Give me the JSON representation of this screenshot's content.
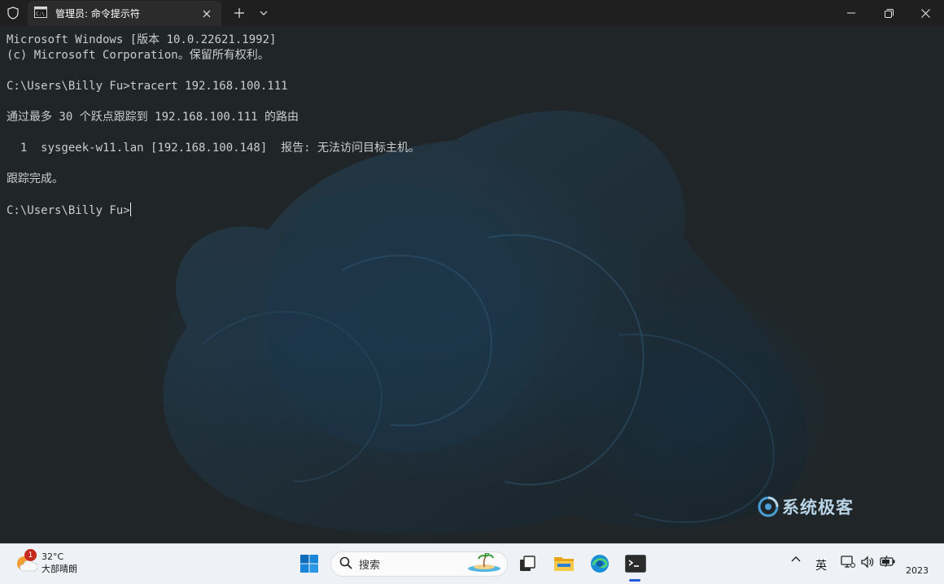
{
  "window": {
    "tab_title": "管理员: 命令提示符"
  },
  "terminal": {
    "lines": [
      "Microsoft Windows [版本 10.0.22621.1992]",
      "(c) Microsoft Corporation。保留所有权利。",
      "",
      "C:\\Users\\Billy Fu>tracert 192.168.100.111",
      "",
      "通过最多 30 个跃点跟踪到 192.168.100.111 的路由",
      "",
      "  1  sysgeek-w11.lan [192.168.100.148]  报告: 无法访问目标主机。",
      "",
      "跟踪完成。",
      "",
      "C:\\Users\\Billy Fu>"
    ]
  },
  "watermark": {
    "text": "系统极客"
  },
  "taskbar": {
    "weather": {
      "temperature": "32°C",
      "condition": "大部晴朗",
      "badge": "1"
    },
    "search_placeholder": "搜索",
    "ime_label": "英",
    "clock": "2023"
  },
  "colors": {
    "terminal_text": "#cccccc",
    "titlebar": "#1f1f1f",
    "tab": "#2b2b2b",
    "taskbar": "#eef1f6",
    "accent": "#1e5bd6"
  },
  "icons": {
    "titlebar": [
      "shield-icon",
      "cmd-icon",
      "close-icon",
      "plus-icon",
      "chevron-down-icon",
      "minimize-icon",
      "maximize-icon",
      "close-window-icon"
    ],
    "taskbar": [
      "weather-icon",
      "start-icon",
      "search-icon",
      "task-view-icon",
      "file-explorer-icon",
      "edge-icon",
      "terminal-icon"
    ],
    "tray": [
      "chevron-up-icon",
      "network-icon",
      "volume-icon",
      "battery-icon"
    ]
  }
}
